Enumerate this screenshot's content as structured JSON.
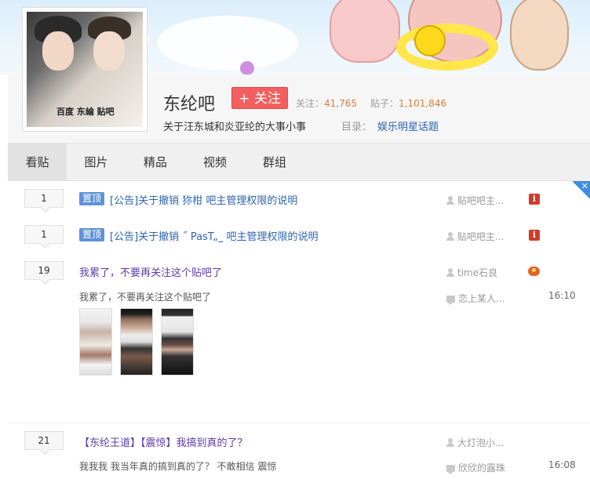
{
  "forum": {
    "name": "东纶吧",
    "follow_label": "+ 关注",
    "followers_label": "关注：",
    "followers_count": "41,765",
    "posts_label": "贴子：",
    "posts_count": "1,101,846",
    "slogan": "关于汪东城和炎亚纶的大事小事",
    "directory_label": "目录：",
    "directory_value": "娱乐明星话题",
    "avatar_logo_text": "百度 东綸 贴吧"
  },
  "nav": {
    "tabs": [
      "看贴",
      "图片",
      "精品",
      "视频",
      "群组"
    ],
    "active": "看贴"
  },
  "threads": [
    {
      "replies": "1",
      "badge": "置顶",
      "title": "[公告]关于撤销 狝柑 吧主管理权限的说明",
      "author": "贴吧吧主...",
      "icon": "warning-icon"
    },
    {
      "replies": "1",
      "badge": "置顶",
      "title": "[公告]关于撤销 ˝ PasT„_ 吧主管理权限的说明",
      "author": "贴吧吧主...",
      "icon": "warning-icon"
    },
    {
      "replies": "19",
      "title": "我累了，不要再关注这个贴吧了",
      "author": "time石良",
      "icon": "game-icon",
      "abstract": "我累了，不要再关注这个贴吧了",
      "last_reply_user": "恋上某人...",
      "last_reply_time": "16:10"
    },
    {
      "replies": "21",
      "title": "【东纶王道】【震惊】我搞到真的了？",
      "author": "大灯泡小...",
      "abstract": "我我我 我当年真的搞到真的了？ 不敢相信 震惊",
      "last_reply_user": "欣欣的露珠",
      "last_reply_time": "16:08"
    }
  ],
  "colors": {
    "accent_blue": "#2d64b3",
    "follow_red": "#f35f5f",
    "badge_blue": "#5e93d8",
    "count_orange": "#e07b3e"
  }
}
